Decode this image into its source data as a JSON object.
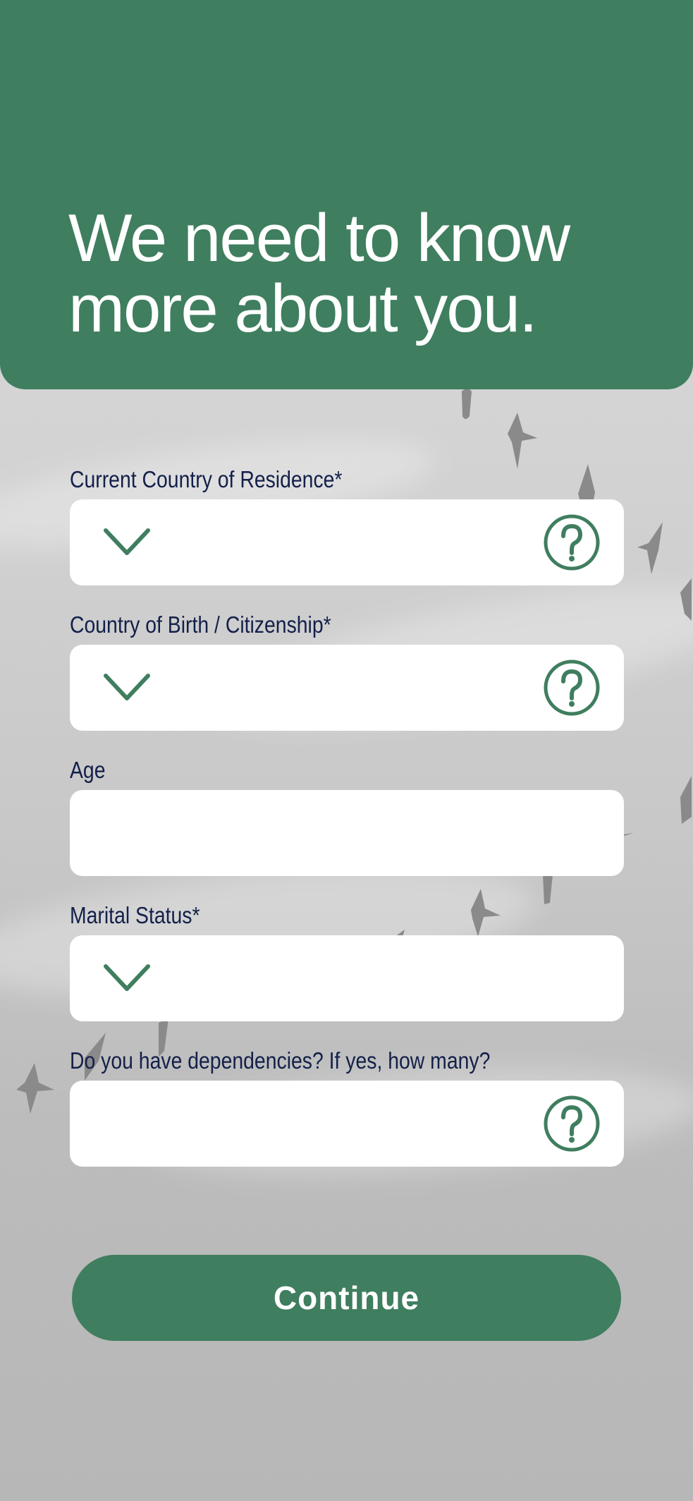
{
  "header": {
    "title": "We need to know\nmore about you."
  },
  "form": {
    "fields": [
      {
        "label": "Current Country of Residence*",
        "value": "",
        "type": "select",
        "has_help": true
      },
      {
        "label": "Country of Birth / Citizenship*",
        "value": "",
        "type": "select",
        "has_help": true
      },
      {
        "label": "Age",
        "value": "",
        "type": "text",
        "has_help": false
      },
      {
        "label": "Marital Status*",
        "value": "",
        "type": "select",
        "has_help": false
      },
      {
        "label": "Do you have dependencies? If yes, how many?",
        "value": "",
        "type": "text",
        "has_help": true
      }
    ]
  },
  "actions": {
    "continue_label": "Continue"
  },
  "colors": {
    "brand_green": "#3f7e5f",
    "label_navy": "#13204a",
    "field_bg": "#ffffff"
  },
  "icons": {
    "select": "chevron-down-icon",
    "help": "help-circle-icon"
  }
}
